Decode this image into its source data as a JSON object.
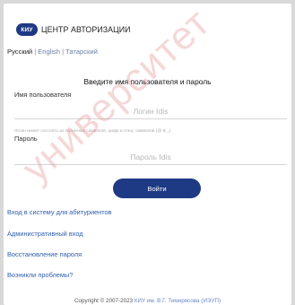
{
  "brand": {
    "logo_text": "КИУ",
    "title": "ЦЕНТР АВТОРИЗАЦИИ",
    "accent_color": "#1f3a84"
  },
  "languages": {
    "active": "Русский",
    "separator": "|",
    "options": [
      "English",
      "Татарский"
    ]
  },
  "form": {
    "title": "Введите имя пользователя и пароль",
    "username_label": "Имя пользователя",
    "username_placeholder": "Логин Idis",
    "username_hint": "Логин может состоять из латинских символов, цифр и спец. символов (@-$._)",
    "password_label": "Пароль",
    "password_placeholder": "Пароль Idis",
    "submit_label": "Войти"
  },
  "links": [
    "Вход в систему для абитуриентов",
    "Административный вход",
    "Восстановление пароля",
    "Возникли проблемы?"
  ],
  "footer": {
    "copyright": "Copyright © 2007-2023",
    "org_link": "КИУ им. В.Г. Тимирясова (ИЭУП)"
  },
  "watermark": "университет"
}
